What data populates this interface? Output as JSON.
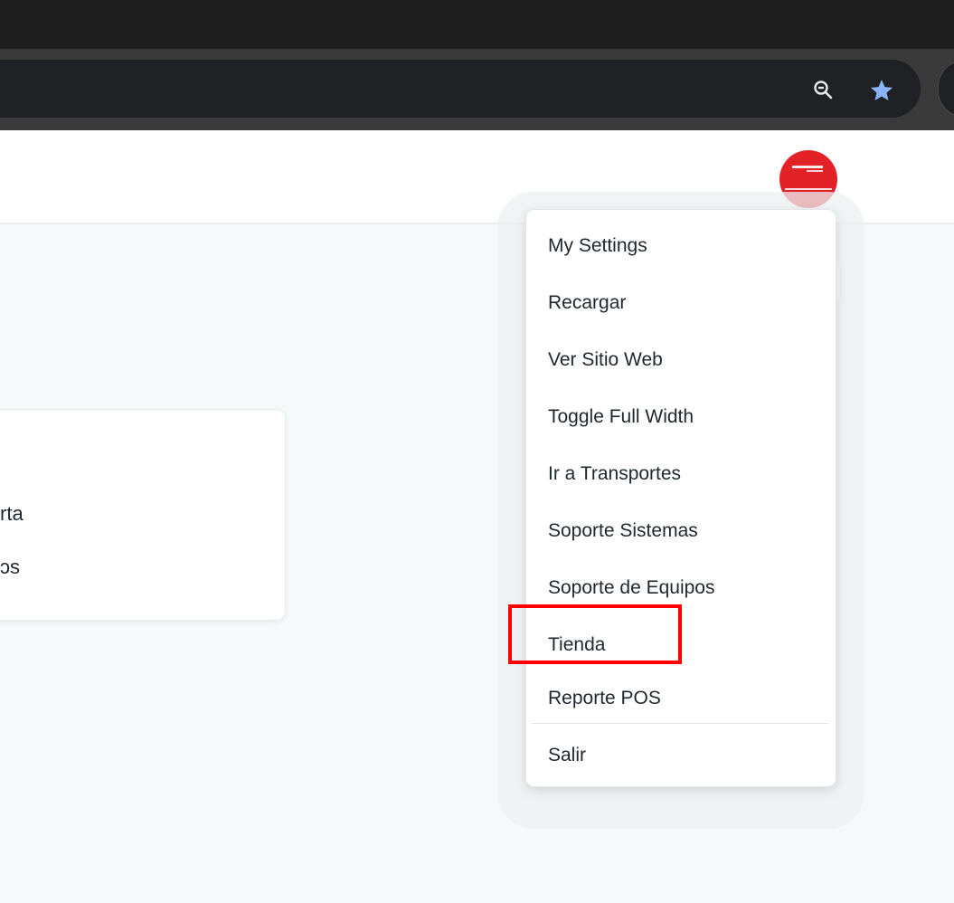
{
  "browser": {
    "zoom_icon": "zoom-out-icon",
    "bookmark_icon": "star-icon",
    "bookmark_color": "#8ab4f8"
  },
  "header": {
    "avatar_color": "#e32228"
  },
  "card": {
    "lines": [
      "rta",
      "ɔs"
    ]
  },
  "menu": {
    "items": [
      {
        "label": "My Settings"
      },
      {
        "label": "Recargar"
      },
      {
        "label": "Ver Sitio Web"
      },
      {
        "label": "Toggle Full Width"
      },
      {
        "label": "Ir a Transportes"
      },
      {
        "label": "Soporte Sistemas"
      },
      {
        "label": "Soporte de Equipos"
      },
      {
        "label": "Tienda"
      },
      {
        "label": "Reporte POS"
      },
      {
        "label": "Salir"
      }
    ],
    "highlighted_item": "Tienda",
    "highlight_color": "#ff0000"
  }
}
